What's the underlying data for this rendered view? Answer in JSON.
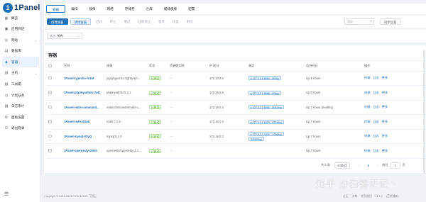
{
  "app": {
    "logo_letter": "1",
    "name": "1Panel"
  },
  "sidebar": {
    "items": [
      {
        "label": "概览",
        "icon": "▦"
      },
      {
        "label": "应用商店",
        "icon": "▣"
      },
      {
        "label": "网站",
        "icon": "◎",
        "arrow": "⌄"
      },
      {
        "label": "数据库",
        "icon": "▤"
      },
      {
        "label": "容器",
        "icon": "◈"
      },
      {
        "label": "主机",
        "icon": "▥",
        "arrow": "⌄"
      },
      {
        "label": "工具箱",
        "icon": "▧"
      },
      {
        "label": "计划任务",
        "icon": "◷"
      },
      {
        "label": "日志审计",
        "icon": "▨"
      },
      {
        "label": "面板设置",
        "icon": "⚙"
      },
      {
        "label": "退出登录",
        "icon": "⏻"
      }
    ],
    "collapse_icon": "☰"
  },
  "tabs": [
    "容器",
    "编排",
    "镜像",
    "网络",
    "存储卷",
    "仓库",
    "编排模版",
    "配置"
  ],
  "toolbar": {
    "create": "创建容器",
    "clean": "清理容器",
    "actions": [
      "启动",
      "停止",
      "重启",
      "强制停止",
      "暂停",
      "恢复",
      "删除"
    ],
    "search_placeholder": "搜索",
    "sync": "同步远程"
  },
  "filter": {
    "label": "状态",
    "value": "所有"
  },
  "panel": {
    "title": "容器",
    "columns": [
      "名称",
      "镜像",
      "状态",
      "资源使用率",
      "IP 地址",
      "端口",
      "运行时长",
      "操作"
    ],
    "rows": [
      {
        "name": "1Panel-typecho-fo1M",
        "image": "joyqi/typecho:nightly-ph...",
        "status": "已启动",
        "usage": "—",
        "ip": "172.18.0.6",
        "ports": [
          "▸ 127.0.0.1:8080→80/tcp"
        ],
        "uptime": "Up 6 hours"
      },
      {
        "name": "1Panel-phpmyadmin-Jv4t",
        "image": "phpmyadmin:5.2.1",
        "status": "已启动",
        "usage": "—",
        "ip": "172.18.0.5",
        "ports": [
          "▸ 127.0.0.1:8888→80/tcp"
        ],
        "uptime": "Up 6 hours"
      },
      {
        "name": "1Panel-redis-command...",
        "image": "rediscommander/redis-c...",
        "status": "已启动",
        "usage": "—",
        "ip": "172.18.0.4",
        "ports": [
          "▸ 127.0.0.1:8085→8081/tcp"
        ],
        "uptime": "Up 7 hours (healthy)"
      },
      {
        "name": "1Panel-redis-8Xp6",
        "image": "redis:7.2.3",
        "status": "已启动",
        "usage": "—",
        "ip": "172.18.0.3",
        "ports": [
          "▸ 127.0.0.1:6379→6379/tcp"
        ],
        "uptime": "Up 7 hours"
      },
      {
        "name": "1Panel-mysql-X0yQ",
        "image": "mysql:8.2.0",
        "status": "已启动",
        "usage": "—",
        "ip": "172.18.0.2",
        "ports": [
          "▸ 127.0.0.1:3306→3306/tcp",
          "33060/tcp"
        ],
        "uptime": "Up 7 hours"
      },
      {
        "name": "1Panel-openresty-Mi0m",
        "image": "openresty/openresty:1.2...",
        "status": "已启动",
        "usage": "—",
        "ip": "",
        "ports": [],
        "uptime": "Up 7 hours"
      }
    ],
    "row_actions": [
      "终端",
      "日志",
      "更多"
    ]
  },
  "pager": {
    "total": "共 6 条",
    "page_size": "10条/页",
    "prev": "‹",
    "page": "1",
    "next": "›",
    "goto_label": "前往",
    "goto_value": "1",
    "goto_suffix": "页"
  },
  "footer": {
    "copyright": "Copyright © 2014-2023 FIT2CLOUD 飞致云",
    "links": [
      "论坛",
      "文档",
      "联系我们"
    ],
    "version": "v1.9.2",
    "version_badge": "(已是最新)"
  },
  "watermark": "知乎 @白雾茫茫丶"
}
